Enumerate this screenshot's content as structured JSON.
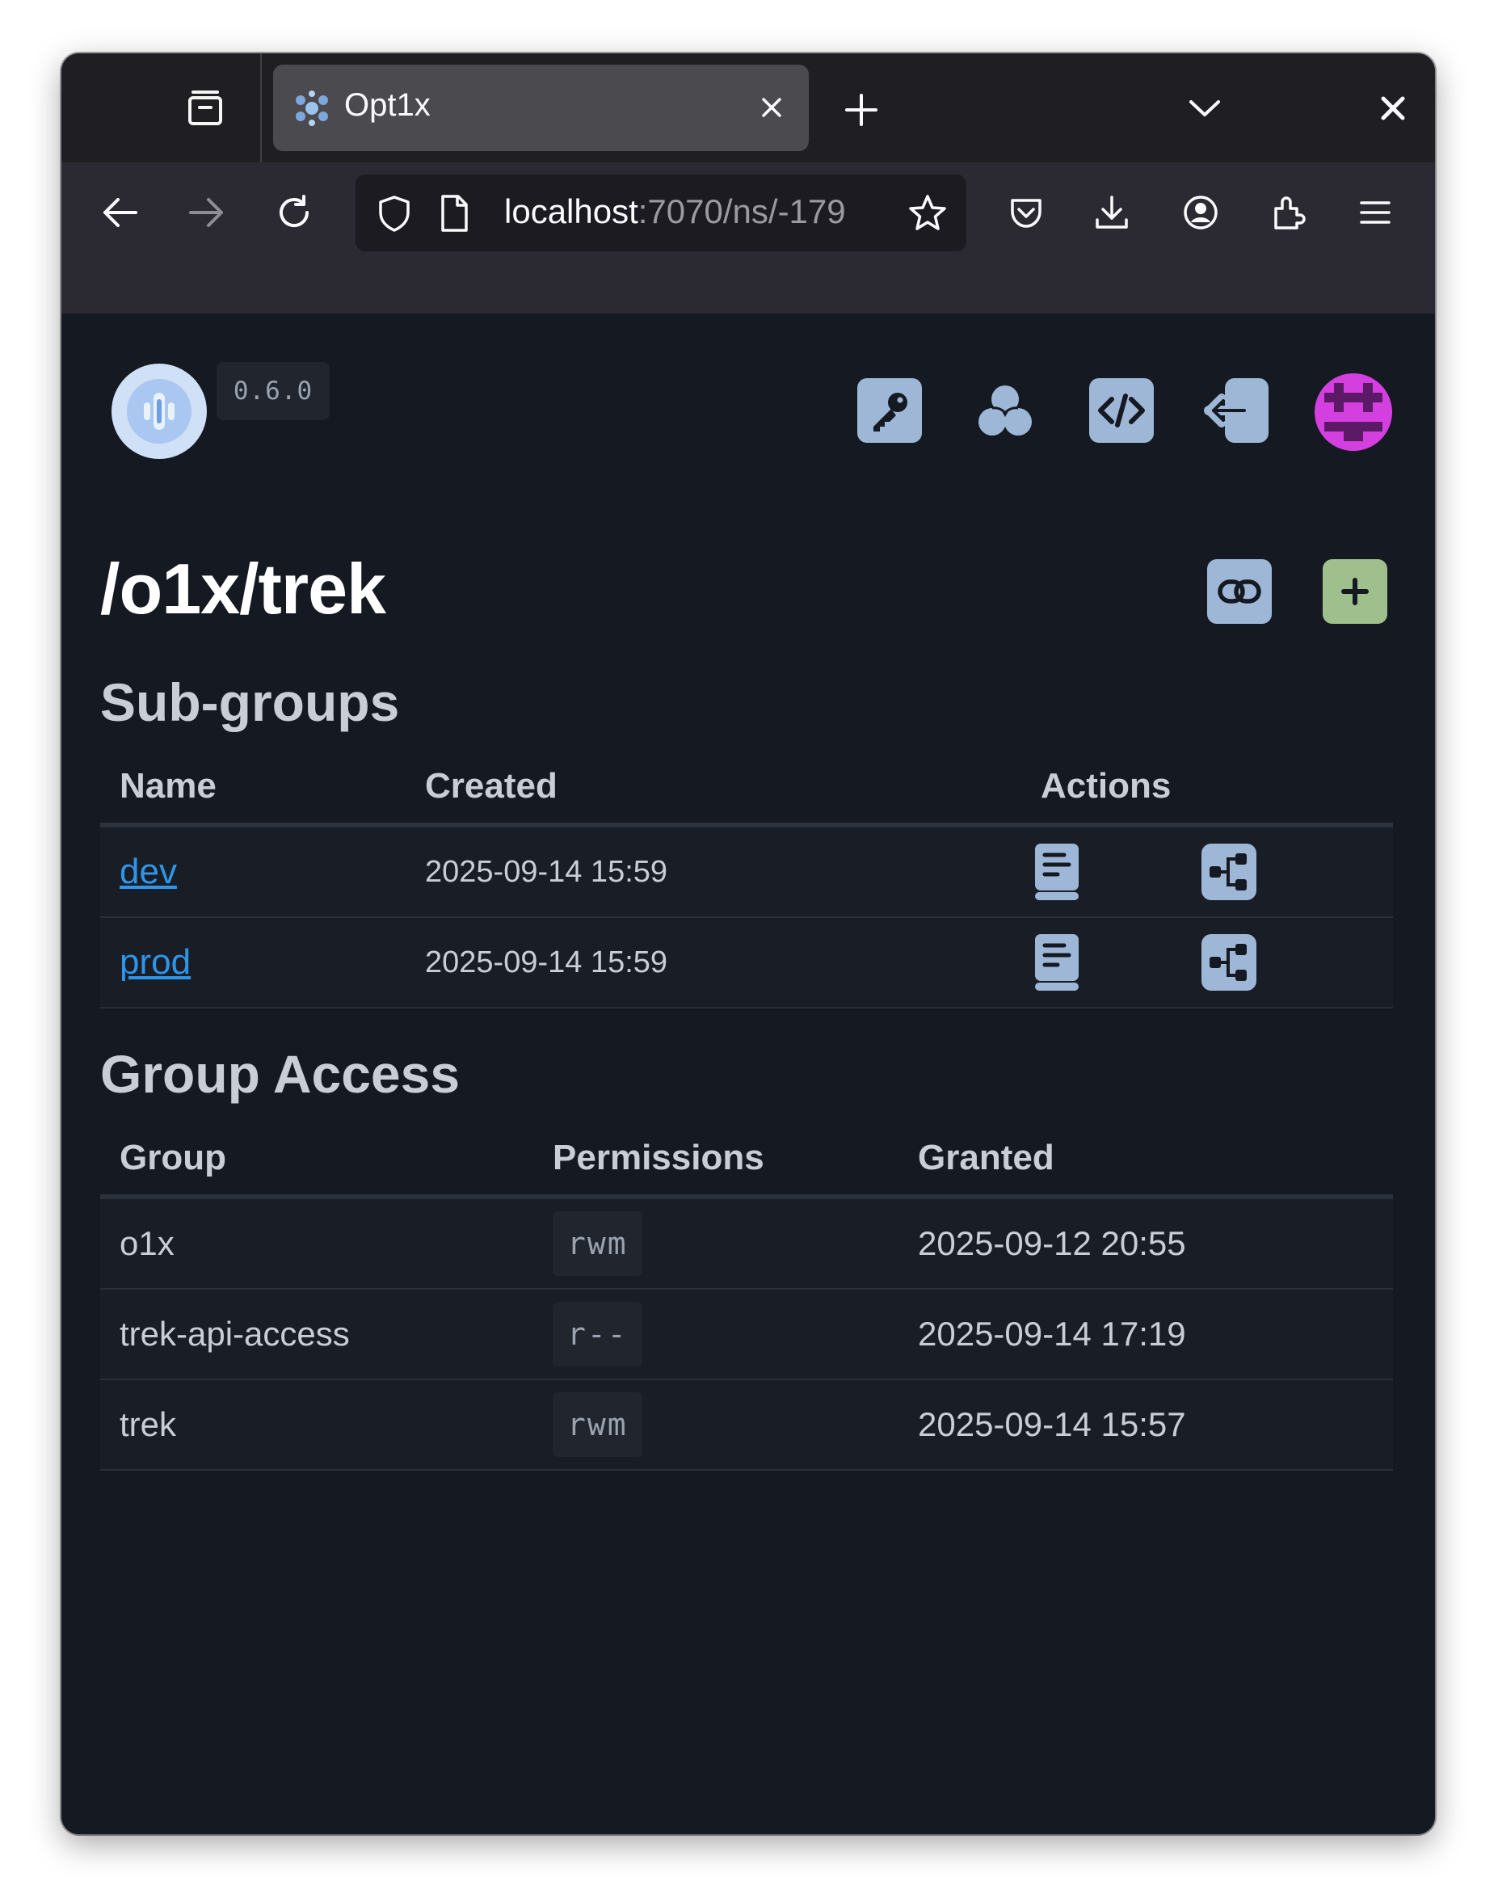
{
  "browser": {
    "tab_title": "Opt1x",
    "url_host": "localhost",
    "url_rest": ":7070/ns/-179"
  },
  "app": {
    "version": "0.6.0",
    "header_icons": [
      "key-icon",
      "groups-icon",
      "code-icon",
      "sign-out-icon",
      "user-avatar"
    ]
  },
  "page": {
    "title": "/o1x/trek"
  },
  "subgroups": {
    "heading": "Sub-groups",
    "columns": [
      "Name",
      "Created",
      "Actions"
    ],
    "rows": [
      {
        "name": "dev",
        "created": "2025-09-14 15:59"
      },
      {
        "name": "prod",
        "created": "2025-09-14 15:59"
      }
    ]
  },
  "group_access": {
    "heading": "Group Access",
    "columns": [
      "Group",
      "Permissions",
      "Granted"
    ],
    "rows": [
      {
        "group": "o1x",
        "permissions": "rwm",
        "granted": "2025-09-12 20:55"
      },
      {
        "group": "trek-api-access",
        "permissions": "r--",
        "granted": "2025-09-14 17:19"
      },
      {
        "group": "trek",
        "permissions": "rwm",
        "granted": "2025-09-14 15:57"
      }
    ]
  },
  "colors": {
    "background": "#151921",
    "accent_link": "#2f95e8",
    "icon_fill": "#9fb7d6",
    "add_button": "#9fc08d",
    "avatar": "#d43fe0"
  }
}
